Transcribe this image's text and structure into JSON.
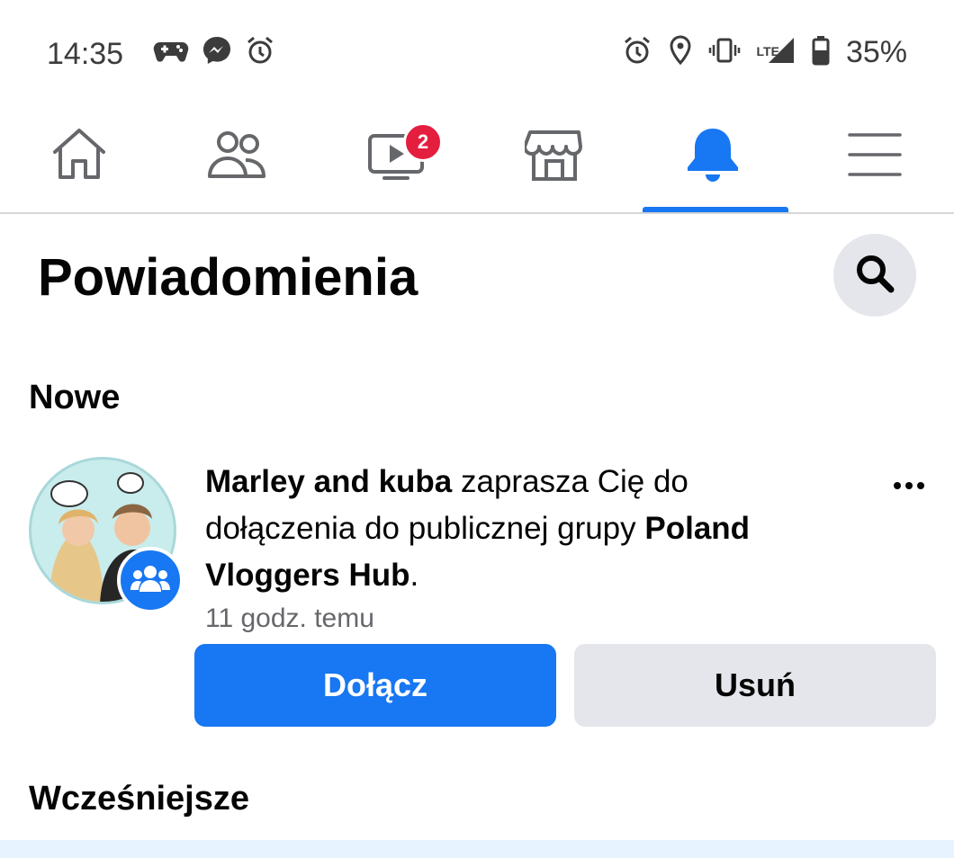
{
  "status_bar": {
    "time": "14:35",
    "battery": "35%",
    "network": "LTE",
    "left_icons": [
      "game-controller-icon",
      "messenger-icon",
      "alarm-icon"
    ],
    "right_icons": [
      "alarm-icon",
      "location-icon",
      "vibrate-icon",
      "signal-icon",
      "battery-icon"
    ]
  },
  "nav": {
    "items": [
      {
        "icon": "home-icon"
      },
      {
        "icon": "friends-icon"
      },
      {
        "icon": "watch-icon",
        "badge": "2"
      },
      {
        "icon": "marketplace-icon"
      },
      {
        "icon": "bell-icon",
        "active": true
      },
      {
        "icon": "menu-icon"
      }
    ],
    "accent": "#1877f2"
  },
  "header": {
    "title": "Powiadomienia"
  },
  "sections": {
    "new_label": "Nowe",
    "earlier_label": "Wcześniejsze"
  },
  "notification": {
    "actor": "Marley and kuba",
    "text_1": " zaprasza Cię do dołączenia do publicznej grupy ",
    "group": "Poland Vloggers Hub",
    "text_2": ".",
    "time": "11 godz. temu",
    "join_label": "Dołącz",
    "remove_label": "Usuń"
  },
  "colors": {
    "primary": "#1877f2",
    "badge_red": "#e41e3f",
    "secondary_bg": "#e4e6eb",
    "unread_bg": "#e7f3ff"
  }
}
